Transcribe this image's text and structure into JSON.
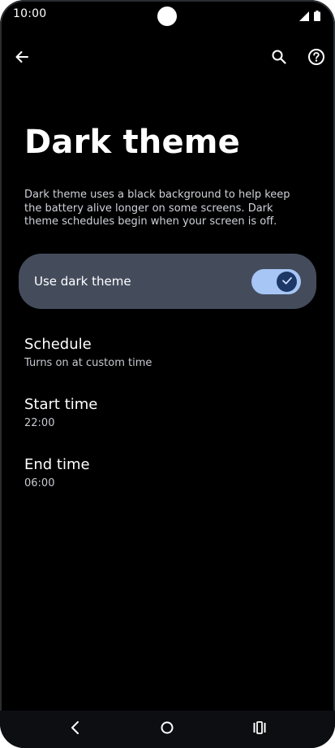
{
  "status_bar": {
    "time": "10:00",
    "icons": [
      "camera-cutout",
      "signal-icon",
      "battery-icon"
    ]
  },
  "top_bar": {
    "back_icon": "arrow-left-icon",
    "search_icon": "search-icon",
    "help_icon": "help-icon"
  },
  "page": {
    "title": "Dark theme",
    "description": "Dark theme uses a black background to help keep the battery alive longer on some screens. Dark theme schedules begin when your screen is off."
  },
  "toggle": {
    "label": "Use dark theme",
    "enabled": true,
    "check_icon": "check-icon"
  },
  "preferences": [
    {
      "title": "Schedule",
      "subtitle": "Turns on at custom time"
    },
    {
      "title": "Start time",
      "subtitle": "22:00"
    },
    {
      "title": "End time",
      "subtitle": "06:00"
    }
  ],
  "nav_bar": {
    "icons": [
      "back-icon",
      "home-icon",
      "recents-icon"
    ]
  },
  "colors": {
    "background": "#000000",
    "toggle_card": "#444c5c",
    "switch_track": "#a7c5f5",
    "switch_knob": "#1d3866",
    "text_primary": "#ffffff",
    "text_secondary": "#c7cad0"
  }
}
